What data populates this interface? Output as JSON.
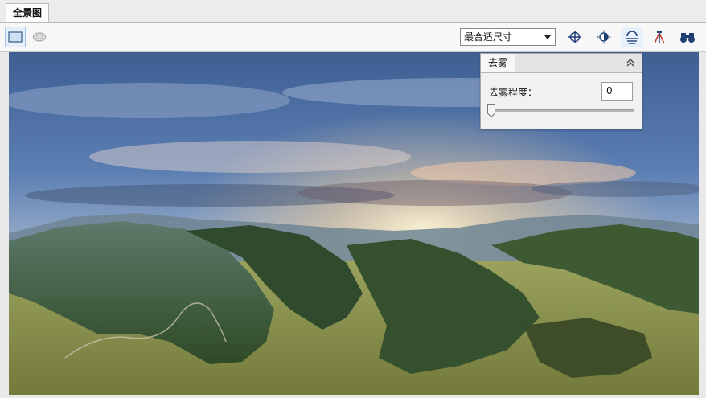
{
  "tab": {
    "label": "全景图"
  },
  "toolbar": {
    "zoom_select": {
      "value": "最合适尺寸"
    }
  },
  "panel": {
    "title": "去雾",
    "label": "去雾程度：",
    "value": "0",
    "slider_level": 0
  }
}
